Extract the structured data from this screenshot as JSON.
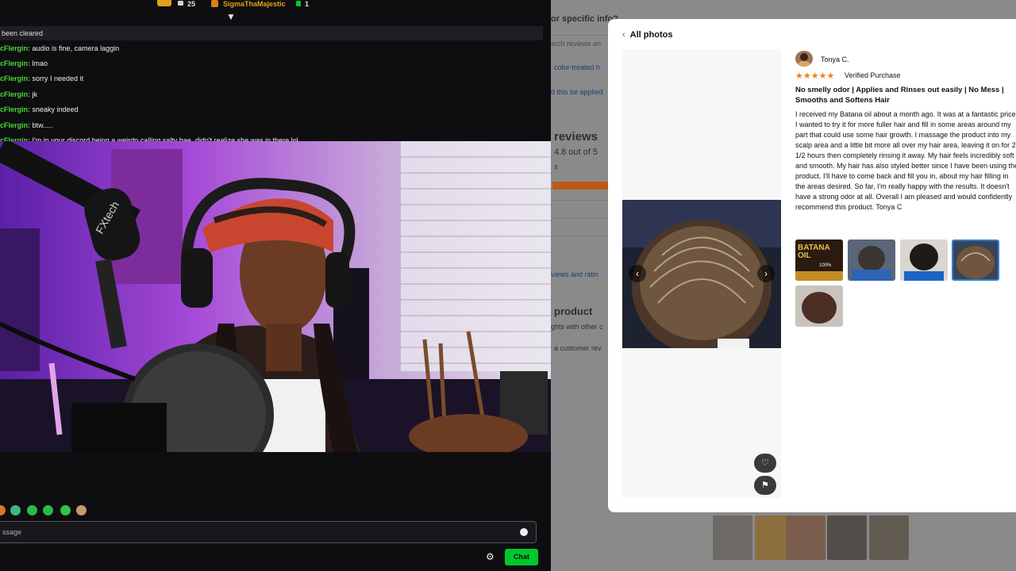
{
  "top_bar": {
    "gift_count": "25",
    "featured_user": "SigmaThaMajestic",
    "bits_count": "1"
  },
  "chat": {
    "cleared_notice": "been cleared",
    "messages": [
      {
        "user": "cFlergin:",
        "text": "audio is fine, camera laggin"
      },
      {
        "user": "cFlergin:",
        "text": "lmao"
      },
      {
        "user": "cFlergin:",
        "text": "sorry I needed it"
      },
      {
        "user": "cFlergin:",
        "text": "jk"
      },
      {
        "user": "cFlergin:",
        "text": "sneaky indeed"
      },
      {
        "user": "cFlergin:",
        "text": "btw....."
      },
      {
        "user": "cFlergin:",
        "text": "I'm in your discord being a weirdo calling salty bae, didn't realize she was in there lol"
      }
    ],
    "input_placeholder": "ssage",
    "chat_button": "Chat",
    "emotes": [
      "emote-1",
      "emote-2",
      "emote-3",
      "emote-4",
      "emote-5",
      "emote-6"
    ]
  },
  "webcam": {
    "mic_brand": "FXtech"
  },
  "background_page": {
    "heading1": "or specific info?",
    "search_placeholder": "arch reviews an",
    "chip": "color-treated h",
    "filter_note": "d this be applied",
    "reviews_heading": "reviews",
    "rating": "4.8 out of 5",
    "rating_tag": "s",
    "reviews_link": "views and ratin",
    "product_heading": "product",
    "product_sub": "ghts with other c",
    "customer_link": "a customer rev"
  },
  "modal": {
    "back_label": "All photos",
    "reviewer": "Tonya C.",
    "stars": "★★★★★",
    "verified": "Verified Purchase",
    "title": "No smelly odor | Applies and Rinses out easily | No Mess | Smooths and Softens Hair",
    "body": "I received my Batana oil about a month ago. It was at a fantastic price. I wanted to try it for more fuller hair and fill in some areas around my part that could use some hair growth. I massage the product into my scalp area and a little bit more all over my hair area, leaving it on for 2 1/2 hours then completely rinsing it away. My hair feels incredibly soft and smooth. My hair has also styled better since I have been using the product. I'll have to come back and fill you in, about my hair filling in the areas desired. So far, I'm really happy with the results. It doesn't have a strong odor at all. Overall I am pleased and would confidently recommend this product. Tonya C",
    "thumb_label": "BATANA OIL",
    "thumb_sub": "100%",
    "colors": {
      "stars": "#f57f17",
      "link": "#1a3f6f"
    }
  }
}
